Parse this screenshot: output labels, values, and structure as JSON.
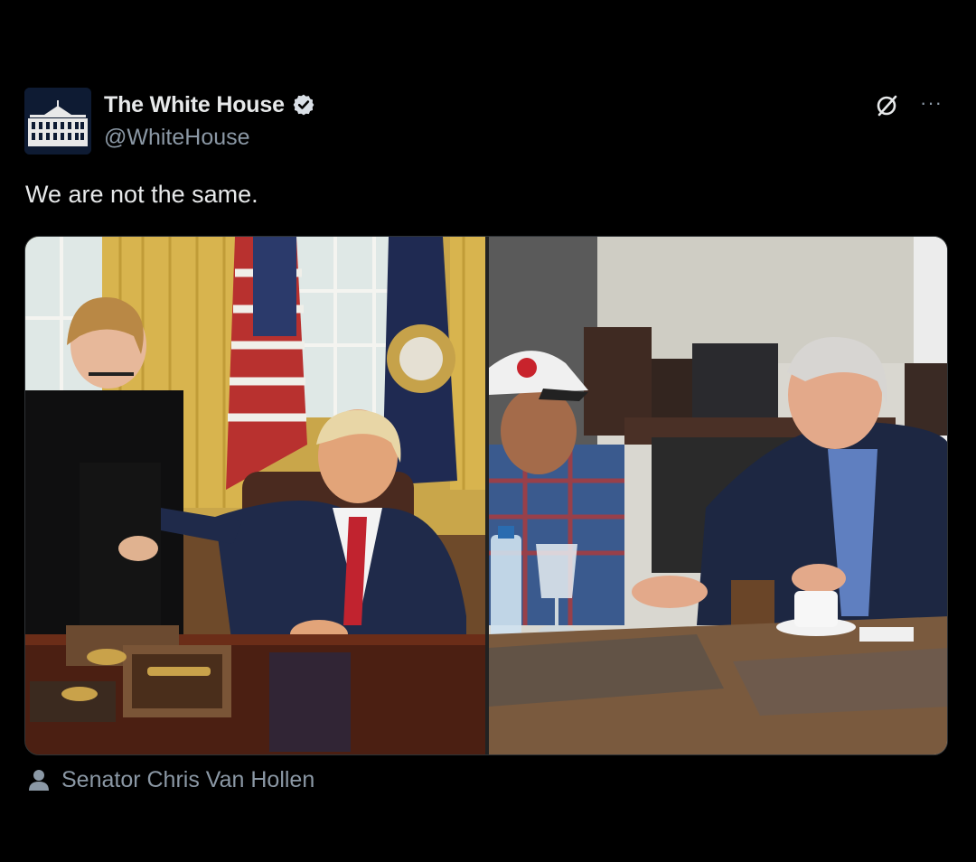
{
  "post": {
    "author": {
      "display_name": "The White House",
      "handle": "@WhiteHouse",
      "verified": true,
      "avatar_icon": "white-house-icon"
    },
    "text": "We are not the same.",
    "media": {
      "images": [
        {
          "icon": "photo-oval-office"
        },
        {
          "icon": "photo-restaurant-table"
        }
      ]
    },
    "tagged": {
      "icon": "person-icon",
      "label": "Senator Chris Van Hollen"
    },
    "actions": {
      "grok_icon": "grok-icon",
      "more_icon": "more-options-icon"
    }
  },
  "colors": {
    "background": "#000000",
    "text_primary": "#e7e9ea",
    "text_secondary": "#8b98a5",
    "verified_badge": "#d9dfe6"
  }
}
